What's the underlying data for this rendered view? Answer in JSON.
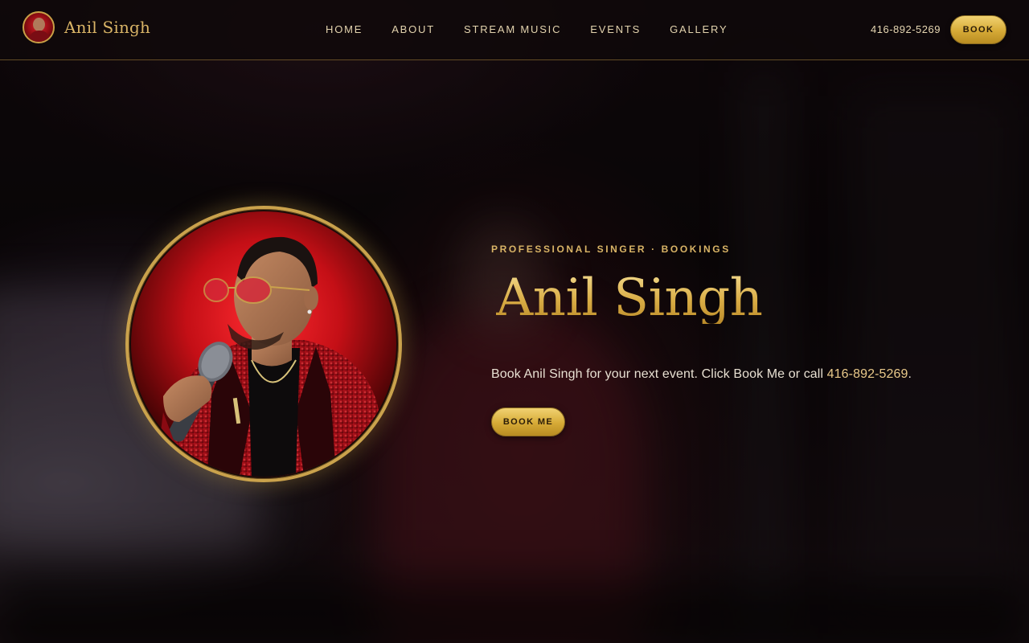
{
  "brand": {
    "name": "Anil Singh",
    "avatar_icon": "singer-portrait-icon"
  },
  "nav": {
    "items": [
      {
        "label": "HOME"
      },
      {
        "label": "ABOUT"
      },
      {
        "label": "STREAM MUSIC"
      },
      {
        "label": "EVENTS"
      },
      {
        "label": "GALLERY"
      }
    ]
  },
  "header": {
    "phone": "416-892-5269",
    "book_label": "BOOK"
  },
  "hero": {
    "eyebrow": "PROFESSIONAL SINGER · BOOKINGS",
    "title": "Anil Singh",
    "subtitle_text": "Book Anil Singh for your next event. Click Book Me or call ",
    "subtitle_phone": "416-892-5269",
    "subtitle_end": ".",
    "cta_label": "BOOK ME",
    "portrait_icon": "singer-with-microphone-photo"
  },
  "colors": {
    "gold": "#d9b466",
    "gold_button": "#d6aa36",
    "background": "#0a0608",
    "jacket_red": "#a01018"
  }
}
